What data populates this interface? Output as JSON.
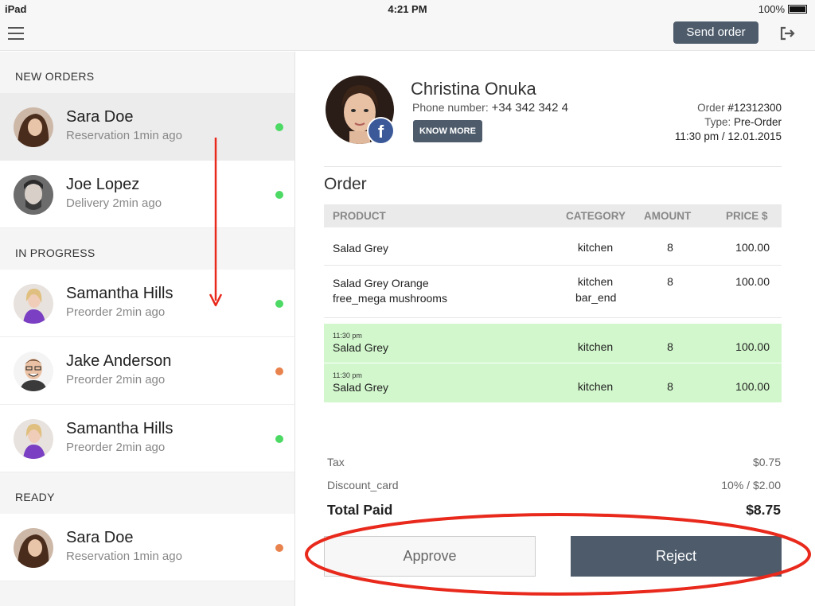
{
  "status_bar": {
    "carrier": "iPad",
    "time": "4:21 PM",
    "battery": "100%"
  },
  "toolbar": {
    "send_order_label": "Send order"
  },
  "sidebar": {
    "sections": [
      {
        "title": "NEW ORDERS",
        "items": [
          {
            "name": "Sara Doe",
            "sub": "Reservation 1min ago",
            "status_color": "#4cd964",
            "selected": true
          },
          {
            "name": "Joe Lopez",
            "sub": "Delivery 2min ago",
            "status_color": "#4cd964",
            "selected": false
          }
        ]
      },
      {
        "title": "IN PROGRESS",
        "items": [
          {
            "name": "Samantha Hills",
            "sub": "Preorder 2min ago",
            "status_color": "#4cd964",
            "selected": false
          },
          {
            "name": "Jake Anderson",
            "sub": "Preorder 2min ago",
            "status_color": "#e8834e",
            "selected": false
          },
          {
            "name": "Samantha Hills",
            "sub": "Preorder 2min ago",
            "status_color": "#4cd964",
            "selected": false
          }
        ]
      },
      {
        "title": "READY",
        "items": [
          {
            "name": "Sara Doe",
            "sub": "Reservation 1min ago",
            "status_color": "#e8834e",
            "selected": false
          }
        ]
      }
    ]
  },
  "customer": {
    "name": "Christina Onuka",
    "phone_label": "Phone number:",
    "phone": "+34 342 342 4",
    "know_more_label": "KNOW MORE",
    "facebook_glyph": "f"
  },
  "order_meta": {
    "order_label": "Order",
    "order_number": "#12312300",
    "type_label": "Type:",
    "type": "Pre-Order",
    "datetime": "11:30 pm / 12.01.2015"
  },
  "order": {
    "title": "Order",
    "headers": {
      "product": "PRODUCT",
      "category": "CATEGORY",
      "amount": "AMOUNT",
      "price": "PRICE $"
    },
    "rows": [
      {
        "time": "",
        "product": "Salad Grey",
        "product2": "",
        "category": "kitchen",
        "category2": "",
        "amount": "8",
        "price": "100.00",
        "highlight": false
      },
      {
        "time": "",
        "product": "Salad Grey Orange",
        "product2": "free_mega mushrooms",
        "category": "kitchen",
        "category2": "bar_end",
        "amount": "8",
        "price": "100.00",
        "highlight": false
      },
      {
        "time": "11:30 pm",
        "product": "Salad Grey",
        "product2": "",
        "category": "kitchen",
        "category2": "",
        "amount": "8",
        "price": "100.00",
        "highlight": true
      },
      {
        "time": "11:30 pm",
        "product": "Salad Grey",
        "product2": "",
        "category": "kitchen",
        "category2": "",
        "amount": "8",
        "price": "100.00",
        "highlight": true
      }
    ]
  },
  "totals": {
    "tax_label": "Tax",
    "tax": "$0.75",
    "discount_label": "Discount_card",
    "discount": "10%  /  $2.00",
    "total_label": "Total Paid",
    "total": "$8.75"
  },
  "actions": {
    "approve_label": "Approve",
    "reject_label": "Reject"
  },
  "annotation_color": "#e8291c"
}
